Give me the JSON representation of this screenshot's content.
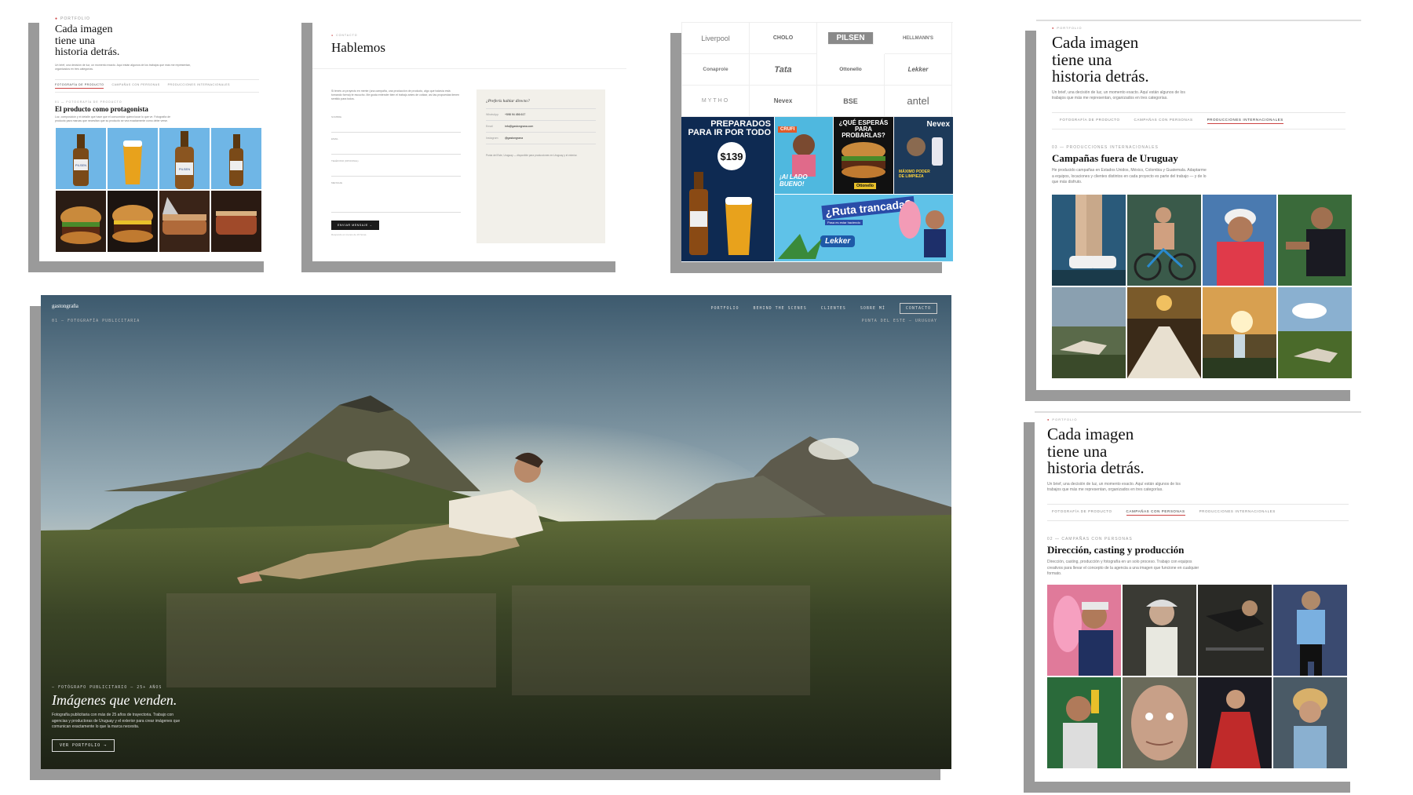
{
  "portfolio_tl": {
    "eyebrow": "Portfolio",
    "title_lines": [
      "Cada imagen",
      "tiene una",
      "historia detrás."
    ],
    "intro": "Un brief, una decisión de luz, un momento exacto. Aquí están algunos de los trabajos que más me representan, organizados en tres categorías.",
    "tabs": [
      "Fotografía de producto",
      "Campañas con personas",
      "Producciones internacionales"
    ],
    "section_eyebrow": "01 — Fotografía de producto",
    "section_title": "El producto como protagonista",
    "section_text": "Luz, composición y el detalle que hace que el consumidor quiera tocar lo que ve. Fotografía de producto para marcas que necesitan que su producto se vea exactamente como debe verse.",
    "tile_labels": [
      "PILSEN",
      "PILSEN",
      "PILSEN",
      "PILSEN"
    ]
  },
  "contact": {
    "eyebrow": "Contacto",
    "title": "Hablemos",
    "intro": "Si tenés un proyecto en mente (una campaña, una producción de producto, algo que todavía está tomando forma) te escucho. Me gusta entender bien el trabajo antes de cotizar, así las propuestas tienen sentido para todos.",
    "fields": [
      "Nombre",
      "Email",
      "Teléfono (opcional)",
      "Mensaje"
    ],
    "submit": "Enviar mensaje →",
    "footnote": "Respondo en menos de 24 horas.",
    "box_title": "¿Preferís hablar directo?",
    "rows": [
      {
        "label": "WhatsApp",
        "value": "+598 94 456 617"
      },
      {
        "label": "Email",
        "value": "info@gastongrana.com"
      },
      {
        "label": "Instagram",
        "value": "@gastongrana"
      }
    ],
    "location": "Punta del Este, Uruguay — disponible para producciones en Uruguay y el exterior."
  },
  "clients": {
    "logos": [
      "Liverpool",
      "CHOLO",
      "PILSEN",
      "HELLMANN'S",
      "Conaprole",
      "Tata",
      "Ottonello",
      "Lekker",
      "MYTHO",
      "Nevex",
      "BSE",
      "antel"
    ],
    "ads": [
      {
        "headline": "PREPARADOS PARA IR POR TODO",
        "badge": "PILSEN",
        "price": "$139"
      },
      {
        "headline": "¡Al LADO BUENO!",
        "badge": "CRUFI"
      },
      {
        "headline": "¿QUÉ ESPERÁS PARA PROBARLAS?",
        "badge": "Ottonello"
      },
      {
        "headline": "MÁXIMO PODER DE LIMPIEZA",
        "badge": "Nevex"
      },
      {
        "headline": "¿Ruta trancada?",
        "badge": "Lekker",
        "sub": "Pasa es estar haciendo"
      }
    ]
  },
  "hero": {
    "logo": "gastongraña",
    "nav": [
      "PORTFOLIO",
      "BEHIND THE SCENES",
      "CLIENTES",
      "SOBRE MÍ",
      "CONTACTO"
    ],
    "caption_left": "01 — FOTOGRAFÍA PUBLICITARIA",
    "caption_right": "PUNTA DEL ESTE — URUGUAY",
    "kicker": "— FOTÓGRAFO PUBLICITARIO — 25+ AÑOS",
    "title": "Imágenes que venden.",
    "desc": "Fotografía publicitaria con más de 25 años de trayectoria. Trabajo con agencias y productoras de Uruguay y el exterior para crear imágenes que comunican exactamente lo que la marca necesita.",
    "cta": "VER PORTFOLIO →"
  },
  "portfolio_r1": {
    "eyebrow": "Portfolio",
    "title_lines": [
      "Cada imagen",
      "tiene una",
      "historia detrás."
    ],
    "intro": "Un brief, una decisión de luz, un momento exacto. Aquí están algunos de los trabajos que más me representan, organizados en tres categorías.",
    "tabs": [
      "Fotografía de producto",
      "Campañas con personas",
      "Producciones internacionales"
    ],
    "section_eyebrow": "03 — Producciones internacionales",
    "section_title": "Campañas fuera de Uruguay",
    "section_text": "He producido campañas en Estados Unidos, México, Colombia y Guatemala. Adaptarme a equipos, locaciones y clientes distintos en cada proyecto es parte del trabajo — y de lo que más disfruto."
  },
  "portfolio_r2": {
    "eyebrow": "Portfolio",
    "title_lines": [
      "Cada imagen",
      "tiene una",
      "historia detrás."
    ],
    "intro": "Un brief, una decisión de luz, un momento exacto. Aquí están algunos de los trabajos que más me representan, organizados en tres categorías.",
    "tabs": [
      "Fotografía de producto",
      "Campañas con personas",
      "Producciones internacionales"
    ],
    "section_eyebrow": "02 — Campañas con personas",
    "section_title": "Dirección, casting y producción",
    "section_text": "Dirección, casting, producción y fotografía en un solo proceso. Trabajo con equipos creativos para llevar el concepto de la agencia a una imagen que funcione en cualquier formato."
  },
  "colors": {
    "accent": "#c44444",
    "shadow": "#9a9a9a",
    "paper": "#f2f0ea",
    "sky_top": "#4b6a80",
    "valley": "#2f3a22"
  }
}
